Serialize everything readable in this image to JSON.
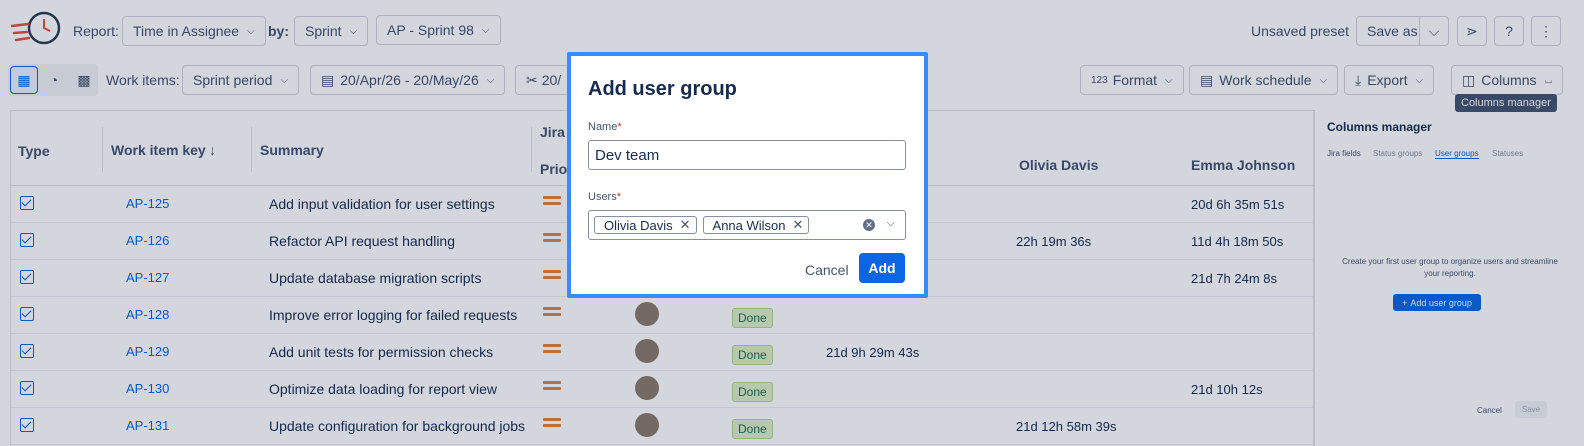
{
  "topbar": {
    "report_label": "Report:",
    "report_value": "Time in Assignee",
    "by_label": "by:",
    "by_value": "Sprint",
    "sprint_value": "AP - Sprint 98",
    "preset_status": "Unsaved preset",
    "save_as_label": "Save as"
  },
  "toolbar": {
    "work_items_label": "Work items:",
    "period_value": "Sprint period",
    "date_range": "20/Apr/26 - 20/May/26",
    "partial_button": "20/",
    "format_label": "Format",
    "work_schedule_label": "Work schedule",
    "export_label": "Export",
    "columns_label": "Columns",
    "columns_tooltip": "Columns manager"
  },
  "table": {
    "headers": {
      "type": "Type",
      "work_item_key": "Work item key",
      "sort_arrow": "↓",
      "summary": "Summary",
      "jira_fields_partial": "Jira f",
      "priority_partial": "Prior",
      "olivia": "Olivia Davis",
      "emma": "Emma Johnson"
    },
    "rows": [
      {
        "key": "AP-125",
        "summary": "Add input validation for user settings",
        "status": "",
        "c1": "",
        "c2": "",
        "c3": "20d 6h 35m 51s"
      },
      {
        "key": "AP-126",
        "summary": "Refactor API request handling",
        "status": "",
        "c1": "",
        "c2": "22h 19m 36s",
        "c3": "11d 4h 18m 50s"
      },
      {
        "key": "AP-127",
        "summary": "Update database migration scripts",
        "status": "",
        "c1": "",
        "c2": "",
        "c3": "21d 7h 24m 8s"
      },
      {
        "key": "AP-128",
        "summary": "Improve error logging for failed requests",
        "status": "Done",
        "c1": "",
        "c2": "",
        "c3": ""
      },
      {
        "key": "AP-129",
        "summary": "Add unit tests for permission checks",
        "status": "Done",
        "c1": "21d 9h 29m 43s",
        "c2": "",
        "c3": ""
      },
      {
        "key": "AP-130",
        "summary": "Optimize data loading for report view",
        "status": "Done",
        "c1": "",
        "c2": "",
        "c3": "21d 10h 12s"
      },
      {
        "key": "AP-131",
        "summary": "Update configuration for background jobs",
        "status": "Done",
        "c1": "",
        "c2": "21d 12h 58m 39s",
        "c3": ""
      }
    ]
  },
  "panel": {
    "title": "Columns manager",
    "tabs": [
      "Jira fields",
      "Status groups",
      "User groups",
      "Statuses"
    ],
    "empty_text": "Create your first user group to organize users and streamline your reporting.",
    "add_group_label": "Add user group",
    "cancel_label": "Cancel",
    "save_label": "Save"
  },
  "modal": {
    "title": "Add user group",
    "name_label": "Name",
    "name_value": "Dev team",
    "users_label": "Users",
    "required_mark": "*",
    "users": [
      "Olivia Davis",
      "Anna Wilson"
    ],
    "cancel_label": "Cancel",
    "add_label": "Add"
  },
  "colors": {
    "accent": "#0c66e4",
    "modal_border": "#388bff",
    "priority": "#e2833b",
    "done_bg": "#dcefc7"
  }
}
